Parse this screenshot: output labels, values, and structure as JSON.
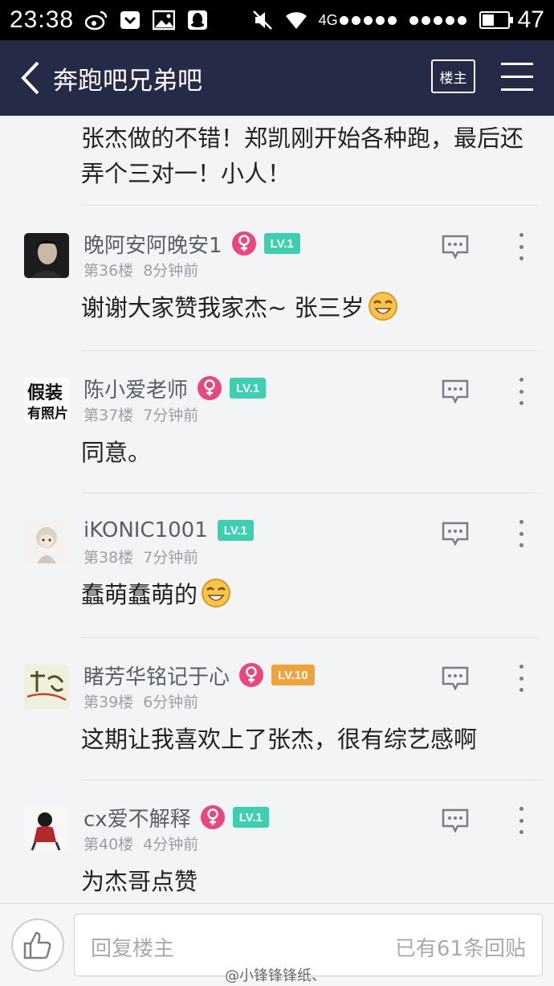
{
  "status_bar": {
    "time": "23:38",
    "network": "4G",
    "battery": "47",
    "battery_level": 0.47
  },
  "header": {
    "title": "奔跑吧兄弟吧",
    "louzhu_label": "楼主"
  },
  "feed": {
    "first_text": "张杰做的不错！郑凯刚开始各种跑，最后还弄个三对一！小人！",
    "posts": [
      {
        "username": "晚阿安阿晚安1",
        "gender": "female",
        "level": "LV.1",
        "level_color": "#3ecfb2",
        "floor": "第36楼",
        "time": "8分钟前",
        "content": "谢谢大家赞我家杰~ 张三岁",
        "emoji": "smile-emoji"
      },
      {
        "username": "陈小爱老师",
        "gender": "female",
        "level": "LV.1",
        "level_color": "#3ecfb2",
        "floor": "第37楼",
        "time": "7分钟前",
        "content": "同意。",
        "emoji": ""
      },
      {
        "username": "iKONIC1001",
        "gender": "",
        "level": "LV.1",
        "level_color": "#3ecfb2",
        "floor": "第38楼",
        "time": "7分钟前",
        "content": "蠢萌蠢萌的",
        "emoji": "smile-emoji"
      },
      {
        "username": "睹芳华铭记于心",
        "gender": "female",
        "level": "LV.10",
        "level_color": "#f0a23c",
        "floor": "第39楼",
        "time": "6分钟前",
        "content": "这期让我喜欢上了张杰，很有综艺感啊",
        "emoji": ""
      },
      {
        "username": "cx爱不解释",
        "gender": "female",
        "level": "LV.1",
        "level_color": "#3ecfb2",
        "floor": "第40楼",
        "time": "4分钟前",
        "content": "为杰哥点赞",
        "emoji": ""
      }
    ]
  },
  "bottom_bar": {
    "reply_placeholder": "回复楼主",
    "reply_count": "已有61条回贴"
  },
  "watermark": "@小锋锋锋纸、",
  "colors": {
    "header_bg": "#252a47",
    "female_badge": "#e8487e",
    "level_teal": "#3ecfb2",
    "level_orange": "#f0a23c"
  }
}
